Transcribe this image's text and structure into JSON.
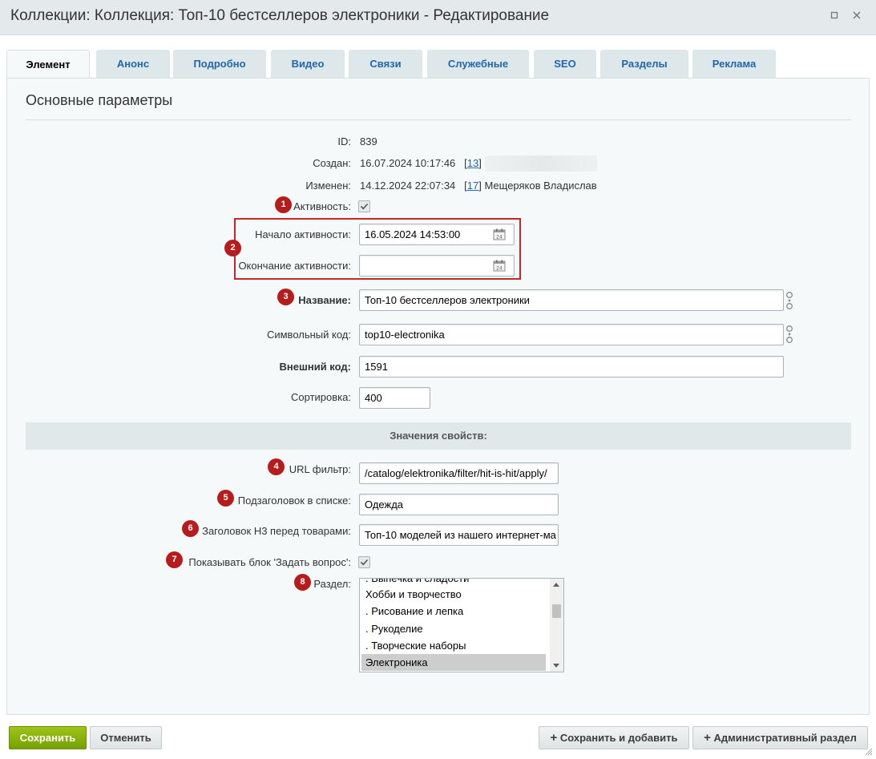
{
  "window": {
    "title": "Коллекции: Коллекция: Топ-10 бестселлеров электроники - Редактирование"
  },
  "tabs": [
    {
      "label": "Элемент"
    },
    {
      "label": "Анонс"
    },
    {
      "label": "Подробно"
    },
    {
      "label": "Видео"
    },
    {
      "label": "Связи"
    },
    {
      "label": "Служебные"
    },
    {
      "label": "SEO"
    },
    {
      "label": "Разделы"
    },
    {
      "label": "Реклама"
    }
  ],
  "section_title": "Основные параметры",
  "fields": {
    "id": {
      "label": "ID:",
      "value": "839"
    },
    "created": {
      "label": "Создан:",
      "value": "16.07.2024 10:17:46",
      "user_link": "13"
    },
    "modified": {
      "label": "Изменен:",
      "value": "14.12.2024 22:07:34",
      "user_link": "17",
      "user_name": "Мещеряков Владислав"
    },
    "active": {
      "label": "Активность:",
      "checked": true
    },
    "active_from": {
      "label": "Начало активности:",
      "value": "16.05.2024 14:53:00"
    },
    "active_to": {
      "label": "Окончание активности:",
      "value": ""
    },
    "name": {
      "label": "Название:",
      "value": "Топ-10 бестселлеров электроники"
    },
    "code": {
      "label": "Символьный код:",
      "value": "top10-electronika"
    },
    "xml_id": {
      "label": "Внешний код:",
      "value": "1591"
    },
    "sort": {
      "label": "Сортировка:",
      "value": "400"
    }
  },
  "props_header": "Значения свойств:",
  "props": {
    "url_filter": {
      "label": "URL фильтр:",
      "value": "/catalog/elektronika/filter/hit-is-hit/apply/"
    },
    "subtitle": {
      "label": "Подзаголовок в списке:",
      "value": "Одежда"
    },
    "h3": {
      "label": "Заголовок H3 перед товарами:",
      "value": "Топ-10 моделей из нашего интернет-ма"
    },
    "ask_block": {
      "label": "Показывать блок 'Задать вопрос':",
      "checked": true
    },
    "section": {
      "label": "Раздел:",
      "options": [
        ". Выпечка и сладости",
        "Хобби и творчество",
        ". Рисование и лепка",
        ". Рукоделие",
        ". Творческие наборы",
        "Электроника"
      ],
      "selected": "Электроника"
    }
  },
  "badges": [
    "1",
    "2",
    "3",
    "4",
    "5",
    "6",
    "7",
    "8"
  ],
  "buttons": {
    "save": "Сохранить",
    "cancel": "Отменить",
    "save_add": "Сохранить и добавить",
    "admin_section": "Административный раздел"
  },
  "icons": [
    "restore-icon",
    "close-icon",
    "calendar-icon",
    "link-icon",
    "checkmark-icon",
    "plus-icon",
    "resize-grip-icon"
  ],
  "colors": {
    "accent_tab": "#2067b0",
    "badge": "#b71c1c",
    "highlight_box": "#c62828",
    "save_button": "#86ad00"
  }
}
